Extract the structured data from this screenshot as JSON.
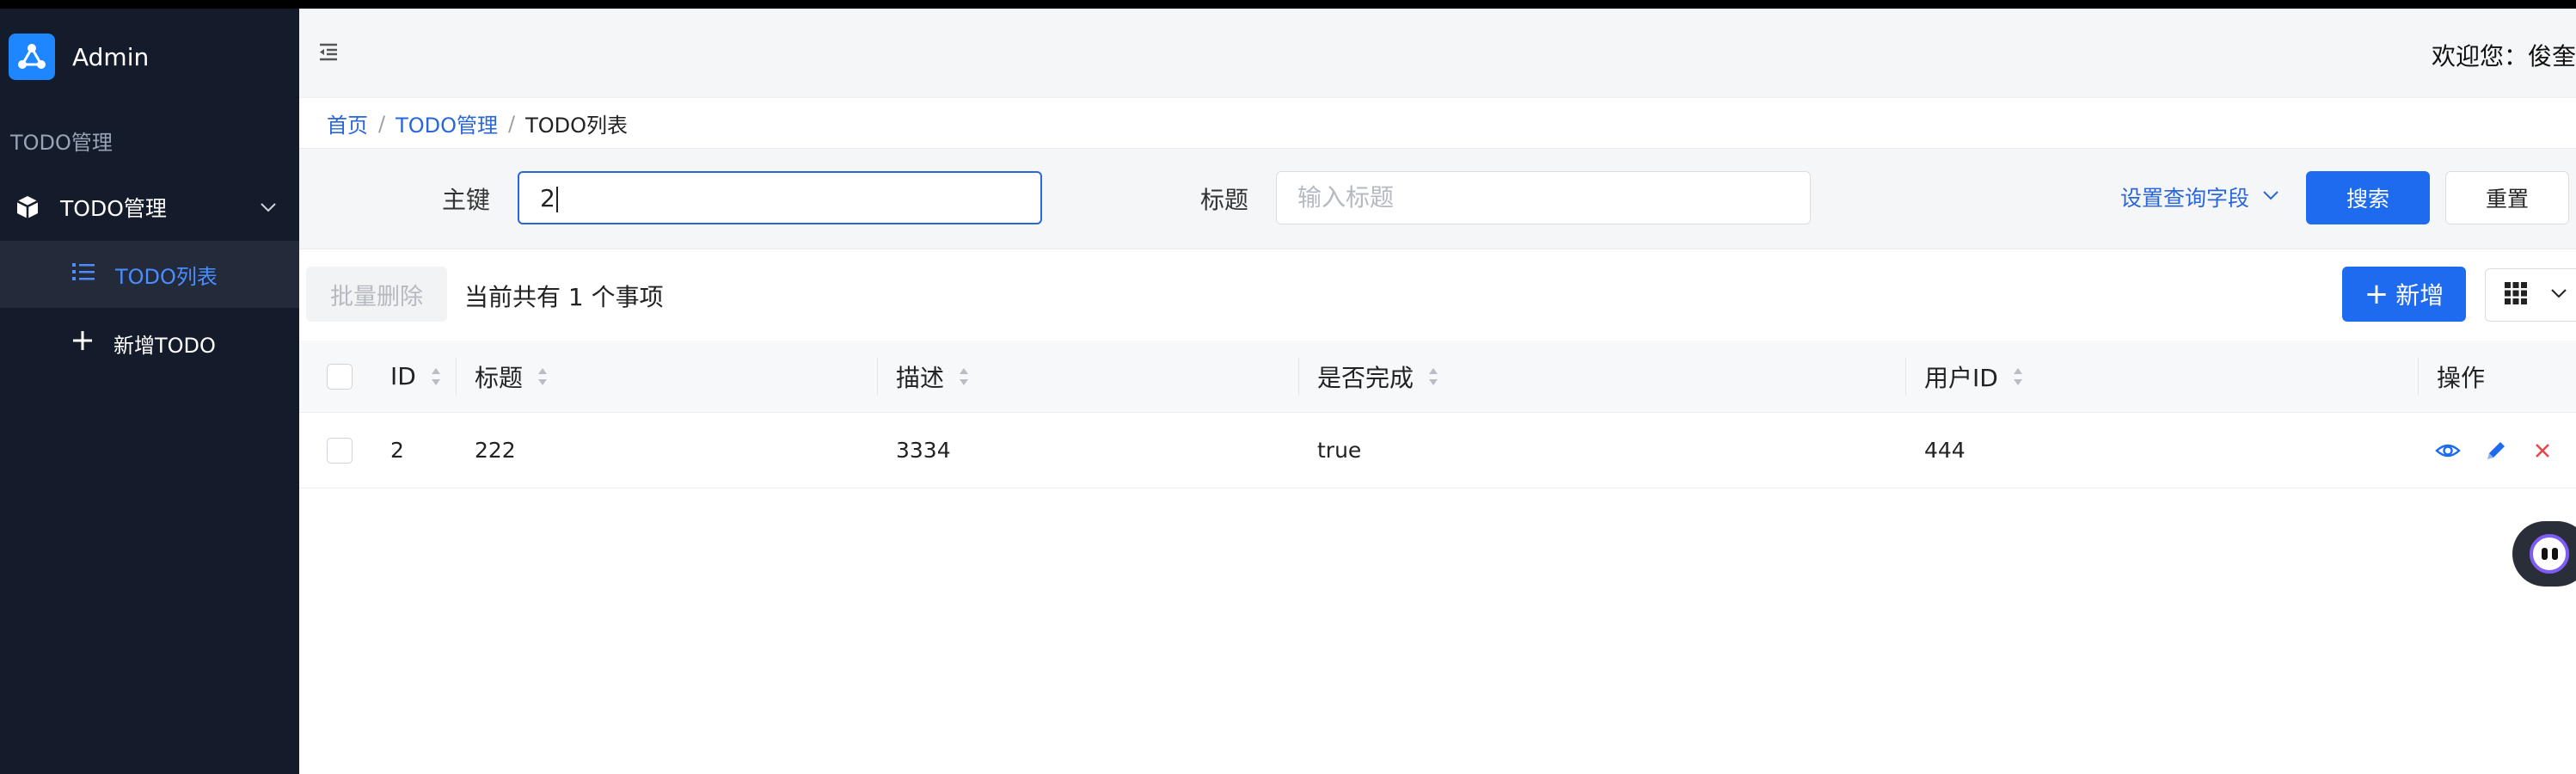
{
  "app": {
    "name": "Admin"
  },
  "sidebar": {
    "group_title": "TODO管理",
    "menu": {
      "label": "TODO管理"
    },
    "items": [
      {
        "label": "TODO列表",
        "active": true
      },
      {
        "label": "新增TODO",
        "active": false
      }
    ]
  },
  "header": {
    "welcome": "欢迎您：俊奎"
  },
  "breadcrumb": {
    "home": "首页",
    "parent": "TODO管理",
    "current": "TODO列表"
  },
  "search": {
    "id_label": "主键",
    "id_value": "2",
    "title_label": "标题",
    "title_placeholder": "输入标题",
    "query_fields_link": "设置查询字段",
    "search_button": "搜索",
    "reset_button": "重置"
  },
  "toolbar": {
    "batch_delete": "批量删除",
    "count_text": "当前共有 1 个事项",
    "add_button": "新增"
  },
  "table": {
    "columns": [
      "ID",
      "标题",
      "描述",
      "是否完成",
      "用户ID",
      "操作"
    ],
    "rows": [
      {
        "id": "2",
        "title": "222",
        "desc": "3334",
        "done": "true",
        "user_id": "444"
      }
    ]
  },
  "colors": {
    "sidebar_bg": "#141b2b",
    "primary": "#1f6bf0",
    "link": "#2a66d8",
    "danger": "#e5484d"
  }
}
